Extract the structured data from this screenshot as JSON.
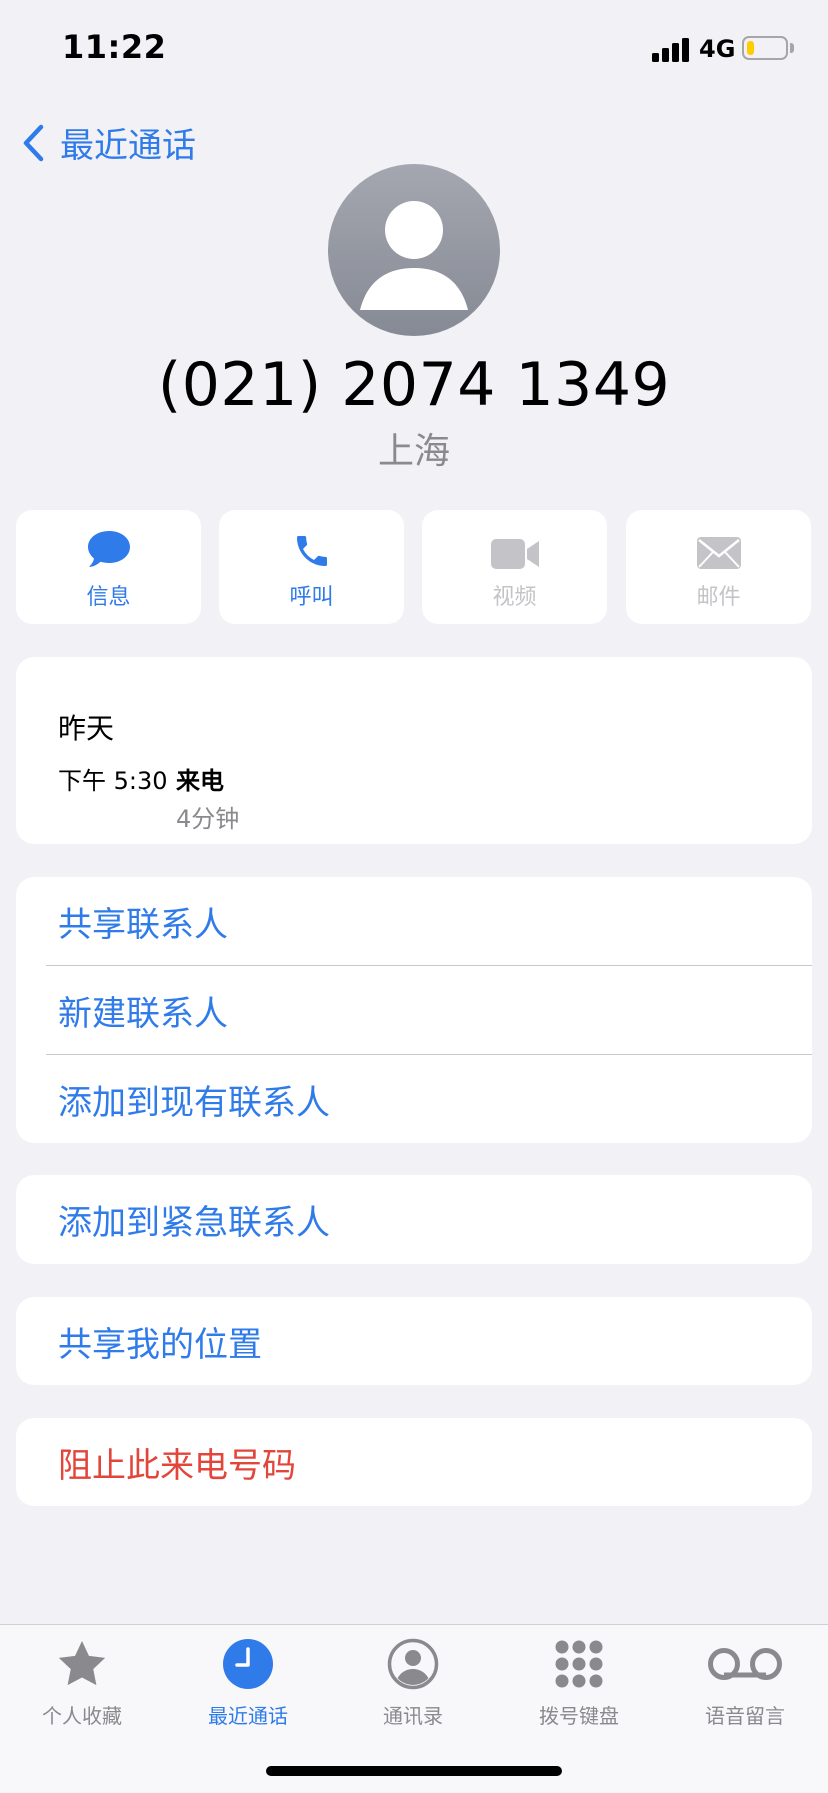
{
  "status_bar": {
    "time": "11:22",
    "network": "4G",
    "battery_level": 0.2
  },
  "nav": {
    "back_label": "最近通话",
    "back_icon": "chevron-left-icon"
  },
  "contact": {
    "avatar_icon": "person-icon",
    "number": "(021) 2074 1349",
    "location": "上海"
  },
  "actions": [
    {
      "label": "信息",
      "icon": "message-icon",
      "enabled": true
    },
    {
      "label": "呼叫",
      "icon": "phone-icon",
      "enabled": true
    },
    {
      "label": "视频",
      "icon": "video-icon",
      "enabled": false
    },
    {
      "label": "邮件",
      "icon": "mail-icon",
      "enabled": false
    }
  ],
  "history": {
    "day": "昨天",
    "time": "下午 5:30",
    "type": "来电",
    "duration": "4分钟"
  },
  "options_group": [
    {
      "label": "共享联系人"
    },
    {
      "label": "新建联系人"
    },
    {
      "label": "添加到现有联系人"
    }
  ],
  "emergency": {
    "label": "添加到紧急联系人"
  },
  "share_location": {
    "label": "共享我的位置"
  },
  "block": {
    "label": "阻止此来电号码"
  },
  "tabs": [
    {
      "label": "个人收藏",
      "icon": "star-icon",
      "active": false
    },
    {
      "label": "最近通话",
      "icon": "clock-icon",
      "active": true
    },
    {
      "label": "通讯录",
      "icon": "contacts-icon",
      "active": false
    },
    {
      "label": "拨号键盘",
      "icon": "keypad-icon",
      "active": false
    },
    {
      "label": "语音留言",
      "icon": "voicemail-icon",
      "active": false
    }
  ],
  "colors": {
    "accent": "#2f7bea",
    "destructive": "#e2463b",
    "background": "#f1f1f6",
    "disabled": "#c4c4c8"
  }
}
